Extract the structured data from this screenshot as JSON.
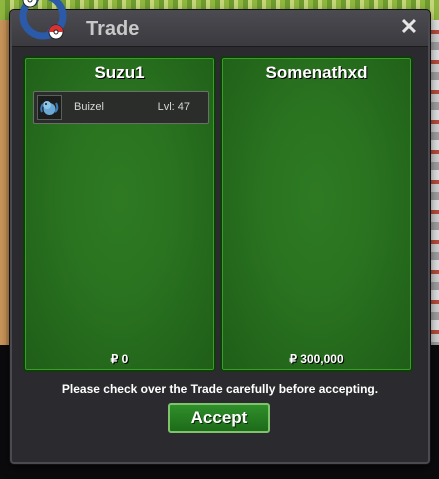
{
  "window": {
    "title": "Trade",
    "close_label": "✕"
  },
  "left_panel": {
    "player_name": "Suzu1",
    "money": "₽ 0",
    "items": [
      {
        "name": "Buizel",
        "level": "Lvl: 47",
        "icon": "buizel-icon"
      }
    ]
  },
  "right_panel": {
    "player_name": "Somenathxd",
    "money": "₽ 300,000",
    "items": []
  },
  "notice": "Please check over the Trade carefully before accepting.",
  "accept_label": "Accept",
  "colors": {
    "panel_green": "#2a7320",
    "dialog_bg": "#2b2b2f",
    "accept_bg": "#1d6b19"
  }
}
